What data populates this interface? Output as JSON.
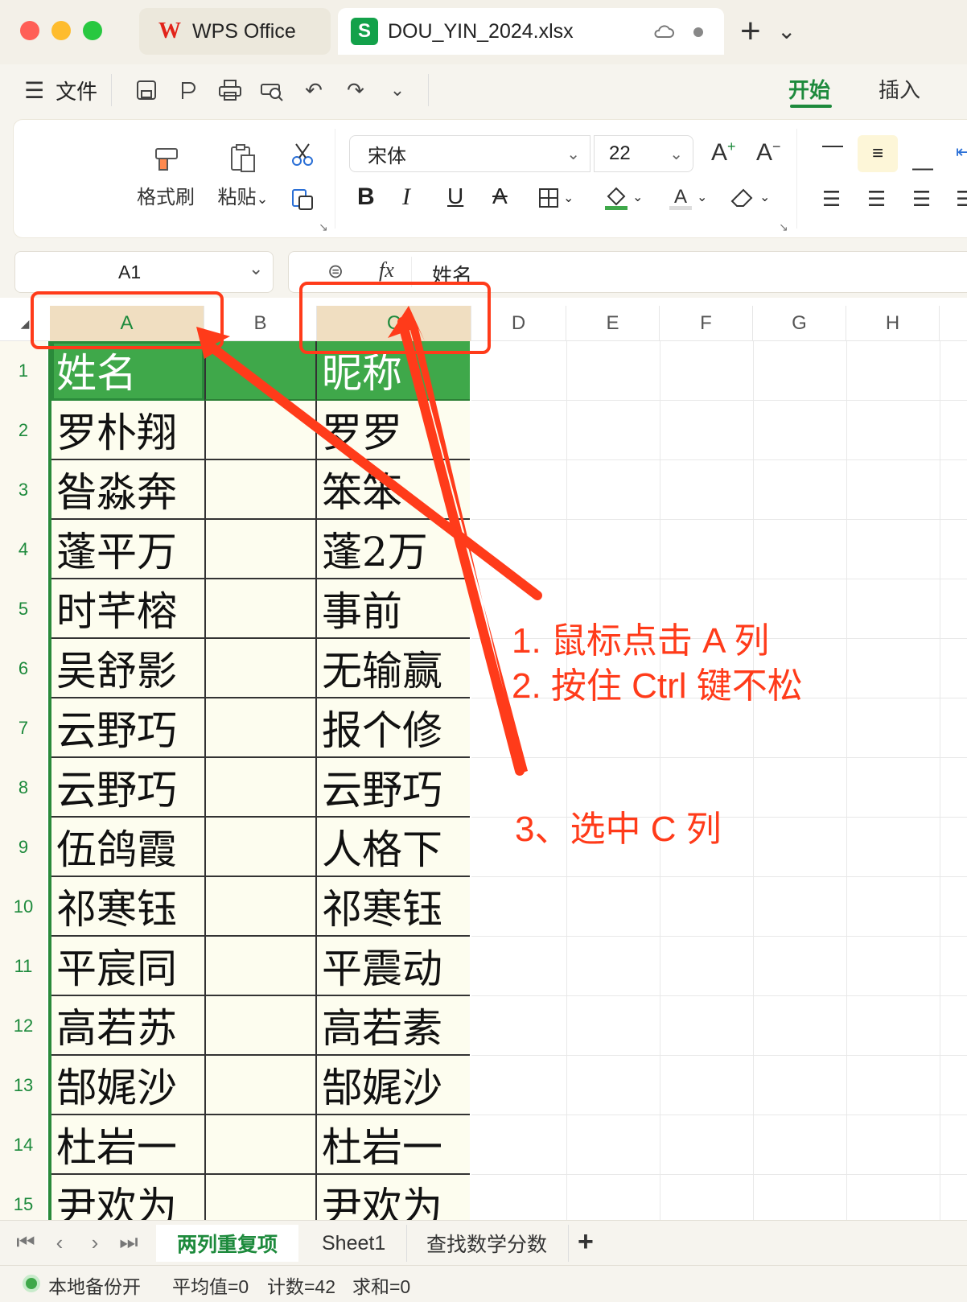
{
  "window": {
    "traffic_lights": [
      "#ff5f57",
      "#febc2e",
      "#28c840"
    ],
    "tabs": [
      {
        "label": "WPS Office",
        "icon": "wps-logo-icon"
      },
      {
        "label": "DOU_YIN_2024.xlsx",
        "icon": "spreadsheet-s-icon"
      }
    ],
    "new_tab": "+",
    "tab_menu": "⌄"
  },
  "menubar": {
    "file_menu": "文件",
    "tabs": [
      "开始",
      "插入"
    ],
    "active_tab": "开始"
  },
  "ribbon": {
    "format_painter": "格式刷",
    "paste": "粘贴",
    "paste_caret": "⌄",
    "font_name": "宋体",
    "font_size": "22",
    "bold": "B",
    "italic": "I",
    "underline": "U",
    "strike": "A",
    "grow_font": "A",
    "shrink_font": "A"
  },
  "formula_bar": {
    "name_box": "A1",
    "fx": "fx",
    "content": "姓名"
  },
  "grid": {
    "columns": [
      "A",
      "B",
      "C",
      "D",
      "E",
      "F",
      "G",
      "H"
    ],
    "selected_columns": [
      "A",
      "C"
    ],
    "rows": [
      "1",
      "2",
      "3",
      "4",
      "5",
      "6",
      "7",
      "8",
      "9",
      "10",
      "11",
      "12",
      "13",
      "14",
      "15"
    ],
    "col_a": [
      "姓名",
      "罗朴翔",
      "昝淼奔",
      "蓬平万",
      "时芊榕",
      "吴舒影",
      "云野巧",
      "云野巧",
      "伍鸽霞",
      "祁寒钰",
      "平宸同",
      "高若苏",
      "郜娓沙",
      "杜岩一",
      "尹欢为"
    ],
    "col_c": [
      "昵称",
      "罗罗",
      "笨笨",
      "蓬2万",
      "事前",
      "无输赢",
      "报个修",
      "云野巧",
      "人格下",
      "祁寒钰",
      "平震动",
      "高若素",
      "郜娓沙",
      "杜岩一",
      "尹欢为"
    ]
  },
  "annotations": {
    "step1": "1. 鼠标点击 A 列",
    "step2": "2. 按住 Ctrl 键不松",
    "step3": "3、选中 C 列",
    "color": "#ff3b1a"
  },
  "sheet_tabs": {
    "tabs": [
      "两列重复项",
      "Sheet1",
      "查找数学分数"
    ],
    "active": "两列重复项",
    "add": "+"
  },
  "status": {
    "backup": "本地备份开",
    "average": "平均值=0",
    "count": "计数=42",
    "sum": "求和=0"
  }
}
